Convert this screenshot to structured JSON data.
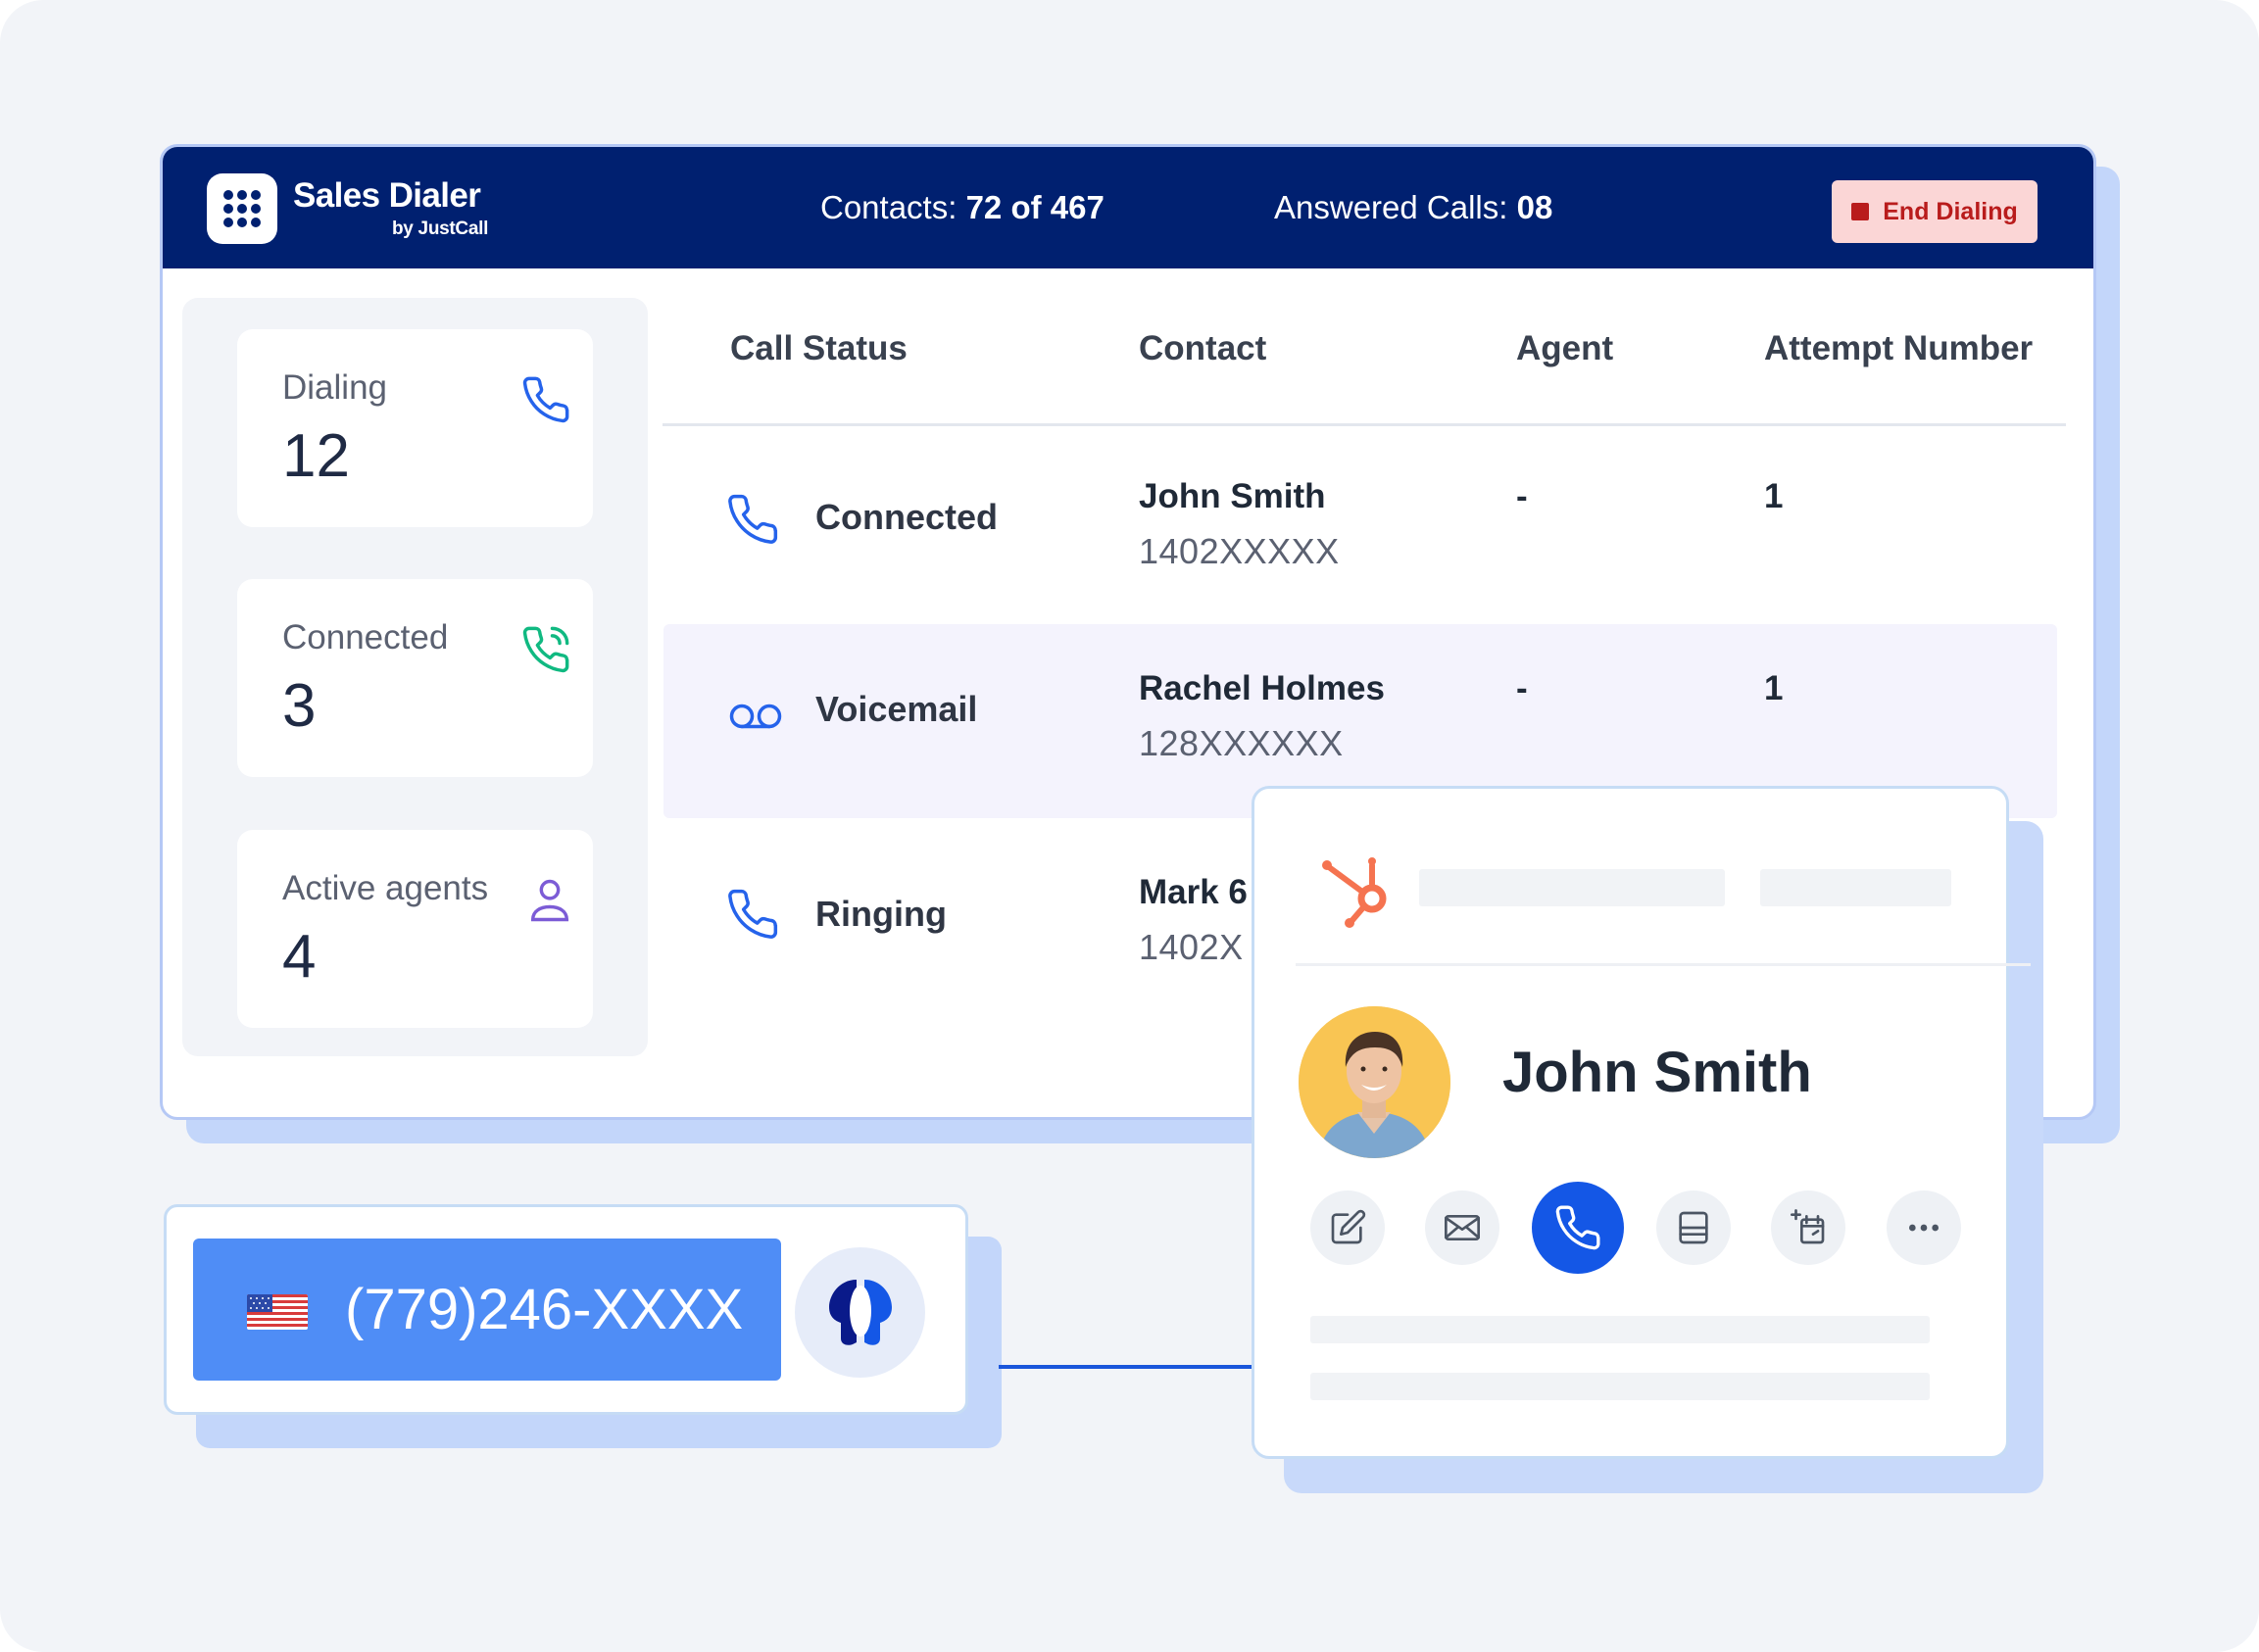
{
  "app": {
    "brand_name": "Sales Dialer",
    "brand_sub": "by JustCall"
  },
  "header": {
    "contacts_label": "Contacts:",
    "contacts_value": "72 of 467",
    "answered_label": "Answered Calls:",
    "answered_value": "08",
    "end_button_label": "End Dialing"
  },
  "stats": [
    {
      "label": "Dialing",
      "value": "12",
      "icon": "phone-icon",
      "color": "#2563eb"
    },
    {
      "label": "Connected",
      "value": "3",
      "icon": "phone-ringing-icon",
      "color": "#10b981"
    },
    {
      "label": "Active agents",
      "value": "4",
      "icon": "user-icon",
      "color": "#7c5cd6"
    }
  ],
  "table": {
    "columns": [
      "Call Status",
      "Contact",
      "Agent",
      "Attempt Number"
    ],
    "rows": [
      {
        "status": "Connected",
        "status_icon": "phone-icon",
        "name": "John Smith",
        "number": "1402XXXXX",
        "agent": "-",
        "attempt": "1"
      },
      {
        "status": "Voicemail",
        "status_icon": "voicemail-icon",
        "name": "Rachel Holmes",
        "number": "128XXXXXX",
        "agent": "-",
        "attempt": "1"
      },
      {
        "status": "Ringing",
        "status_icon": "phone-icon",
        "name": "Mark 6",
        "number": "1402X",
        "agent": "",
        "attempt": ""
      }
    ]
  },
  "dialer": {
    "country_flag": "us-flag-icon",
    "number": "(779)246-XXXX",
    "ai_icon": "ai-assistant-icon"
  },
  "contact_card": {
    "crm_icon": "hubspot-icon",
    "name": "John Smith",
    "actions": [
      "edit-icon",
      "email-icon",
      "call-icon",
      "list-icon",
      "calendar-add-icon",
      "more-icon"
    ]
  },
  "colors": {
    "header_bg": "#002070",
    "accent_blue": "#1457e6",
    "dial_button": "#4f8df6",
    "end_button_bg": "#fbd6d6",
    "end_button_text": "#b91c1c",
    "connected_green": "#10b981",
    "agents_purple": "#7c5cd6",
    "hubspot_orange": "#f57350"
  }
}
